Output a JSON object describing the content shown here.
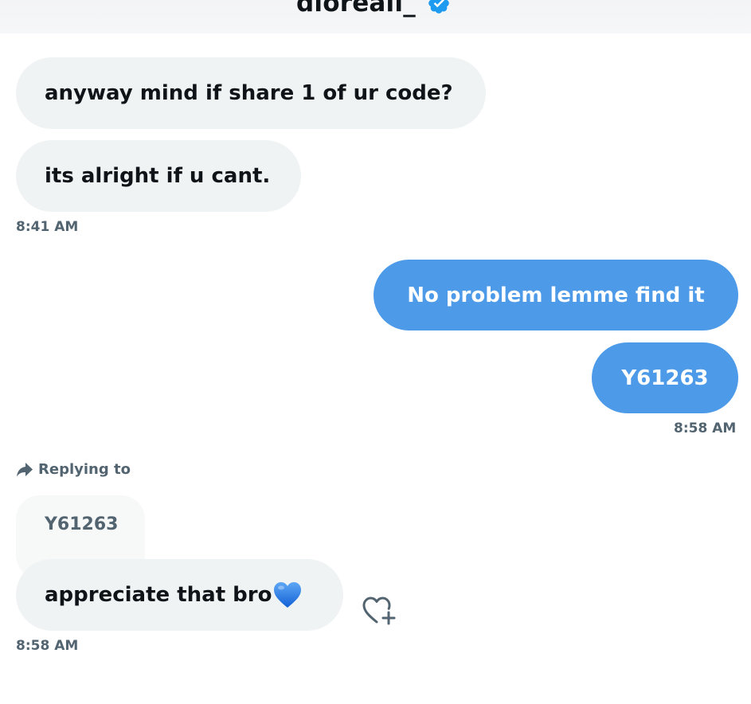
{
  "header": {
    "display_name": "dioreali_",
    "verified_icon": "verified-badge-icon"
  },
  "messages": [
    {
      "side": "incoming",
      "text": "anyway mind if share 1 of ur code?"
    },
    {
      "side": "incoming",
      "text": "its alright if u cant."
    },
    {
      "side": "outgoing",
      "text": "No problem lemme find it"
    },
    {
      "side": "outgoing",
      "text": "Y61263"
    },
    {
      "side": "incoming",
      "text": "appreciate that bro"
    }
  ],
  "timestamps": {
    "t1": "8:41 AM",
    "t2": "8:58 AM",
    "t3": "8:58 AM"
  },
  "reply": {
    "label": "Replying to",
    "quoted_text": "Y61263",
    "icon": "reply-arrow-icon"
  },
  "reaction_button_icon": "heart-add-icon",
  "colors": {
    "outgoing_bubble": "#4c9ae8",
    "incoming_bubble": "#eff3f4",
    "secondary_text": "#536471",
    "verified": "#1d9bf0",
    "emoji_heart": "#1d6fe0"
  }
}
